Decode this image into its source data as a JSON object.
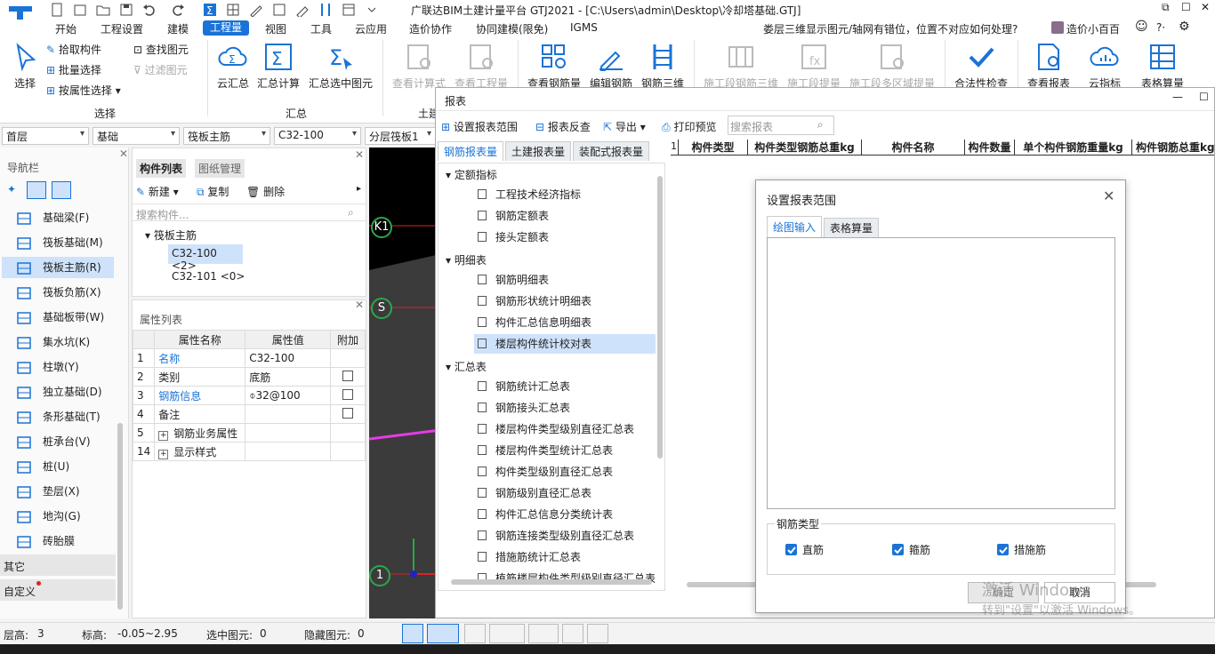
{
  "app": {
    "title": "广联达BIM土建计量平台 GTJ2021 - [C:\\Users\\admin\\Desktop\\冷却塔基础.GTJ]",
    "window_buttons": [
      "⧉",
      "☐",
      "✕"
    ]
  },
  "menu": {
    "items": [
      "开始",
      "工程设置",
      "建模",
      "工程量",
      "视图",
      "工具",
      "云应用",
      "造价协作",
      "协同建模(限免)",
      "IGMS"
    ],
    "active": "工程量",
    "notice": "娄层三维显示图元/轴网有错位，位置不对应如何处理?",
    "user": "造价小百百",
    "right_icons": [
      "?·",
      "⚙"
    ]
  },
  "ribbon": {
    "select_big": "选择",
    "pick": "拾取构件",
    "batch": "批量选择",
    "by_attr": "按属性选择",
    "find": "查找图元",
    "filter": "过滤图元",
    "group_select": "选择",
    "cloud_sum": "云汇总",
    "sum_calc": "汇总计算",
    "sum_selected": "汇总选中图元",
    "group_sum": "汇总",
    "group_civil": "土建",
    "view_formula": "查看计算式",
    "view_qty": "查看工程量",
    "view_rebar_qty": "查看钢筋量",
    "edit_rebar": "编辑钢筋",
    "rebar_3d": "钢筋三维",
    "stage_rebar_3d": "施工段钢筋三维",
    "stage_qty": "施工段提量",
    "stage_multi": "施工段多区域提量",
    "legality": "合法性检查",
    "view_report": "查看报表",
    "cloud_index": "云指标",
    "table_calc": "表格算量"
  },
  "selectors": {
    "floor": "首层",
    "category": "基础",
    "type": "筏板主筋",
    "component": "C32-100",
    "layer": "分层筏板1"
  },
  "nav": {
    "title": "导航栏",
    "items": [
      "基础梁(F)",
      "筏板基础(M)",
      "筏板主筋(R)",
      "筏板负筋(X)",
      "基础板带(W)",
      "集水坑(K)",
      "柱墩(Y)",
      "独立基础(D)",
      "条形基础(T)",
      "桩承台(V)",
      "桩(U)",
      "垫层(X)",
      "地沟(G)",
      "砖胎膜"
    ],
    "selected": "筏板主筋(R)",
    "sections": [
      "其它",
      "自定义"
    ]
  },
  "comp_panel": {
    "tabs": [
      "构件列表",
      "图纸管理"
    ],
    "new": "新建",
    "copy": "复制",
    "delete": "删除",
    "search_placeholder": "搜索构件...",
    "group": "筏板主筋",
    "items": [
      "C32-100 <2>",
      "C32-101 <0>"
    ]
  },
  "prop_panel": {
    "title": "属性列表",
    "headers": [
      "属性名称",
      "属性值",
      "附加"
    ],
    "rows": [
      {
        "no": "1",
        "name": "名称",
        "value": "C32-100"
      },
      {
        "no": "2",
        "name": "类别",
        "value": "底筋"
      },
      {
        "no": "3",
        "name": "钢筋信息",
        "value": "⌽32@100"
      },
      {
        "no": "4",
        "name": "备注",
        "value": ""
      },
      {
        "no": "5",
        "name": "钢筋业务属性",
        "value": ""
      },
      {
        "no": "14",
        "name": "显示样式",
        "value": ""
      }
    ]
  },
  "canvas": {
    "axis_labels": [
      "K1",
      "S",
      "1"
    ]
  },
  "report": {
    "title": "报表",
    "toolbar": [
      "设置报表范围",
      "报表反查",
      "导出",
      "打印预览"
    ],
    "search_placeholder": "搜索报表",
    "tabs": [
      "钢筋报表量",
      "土建报表量",
      "装配式报表量"
    ],
    "tree": [
      {
        "label": "定额指标",
        "children": [
          "工程技术经济指标",
          "钢筋定额表",
          "接头定额表"
        ]
      },
      {
        "label": "明细表",
        "children": [
          "钢筋明细表",
          "钢筋形状统计明细表",
          "构件汇总信息明细表",
          "楼层构件统计校对表"
        ]
      },
      {
        "label": "汇总表",
        "children": [
          "钢筋统计汇总表",
          "钢筋接头汇总表",
          "楼层构件类型级别直径汇总表",
          "楼层构件类型统计汇总表",
          "构件类型级别直径汇总表",
          "钢筋级别直径汇总表",
          "构件汇总信息分类统计表",
          "钢筋连接类型级别直径汇总表",
          "措施筋统计汇总表",
          "植筋楼层构件类型级别直径汇总表"
        ]
      }
    ],
    "selected": "楼层构件统计校对表",
    "table_headers": [
      "构件类型",
      "构件类型钢筋总重kg",
      "构件名称",
      "构件数量",
      "单个构件钢筋重量kg",
      "构件钢筋总重kg"
    ],
    "row_no": "1"
  },
  "dialog": {
    "title": "设置报表范围",
    "tabs": [
      "绘图输入",
      "表格算量"
    ],
    "group_label": "钢筋类型",
    "checks": [
      "直筋",
      "箍筋",
      "措施筋"
    ],
    "ok": "确定",
    "cancel": "取消"
  },
  "watermark": {
    "line1": "激活 Windows",
    "line2": "转到\"设置\"以激活 Windows。"
  },
  "status": {
    "floor_height_label": "层高:",
    "floor_height": "3",
    "elevation_label": "标高:",
    "elevation": "-0.05~2.95",
    "selected_label": "选中图元:",
    "selected": "0",
    "hidden_label": "隐藏图元:",
    "hidden": "0"
  },
  "colors": {
    "accent": "#1a73d6",
    "menu_active_bg": "#1a73d6",
    "canvas_bg": "#000000",
    "axis_green": "#2aa84a",
    "selected_row": "#cfe2fb"
  }
}
